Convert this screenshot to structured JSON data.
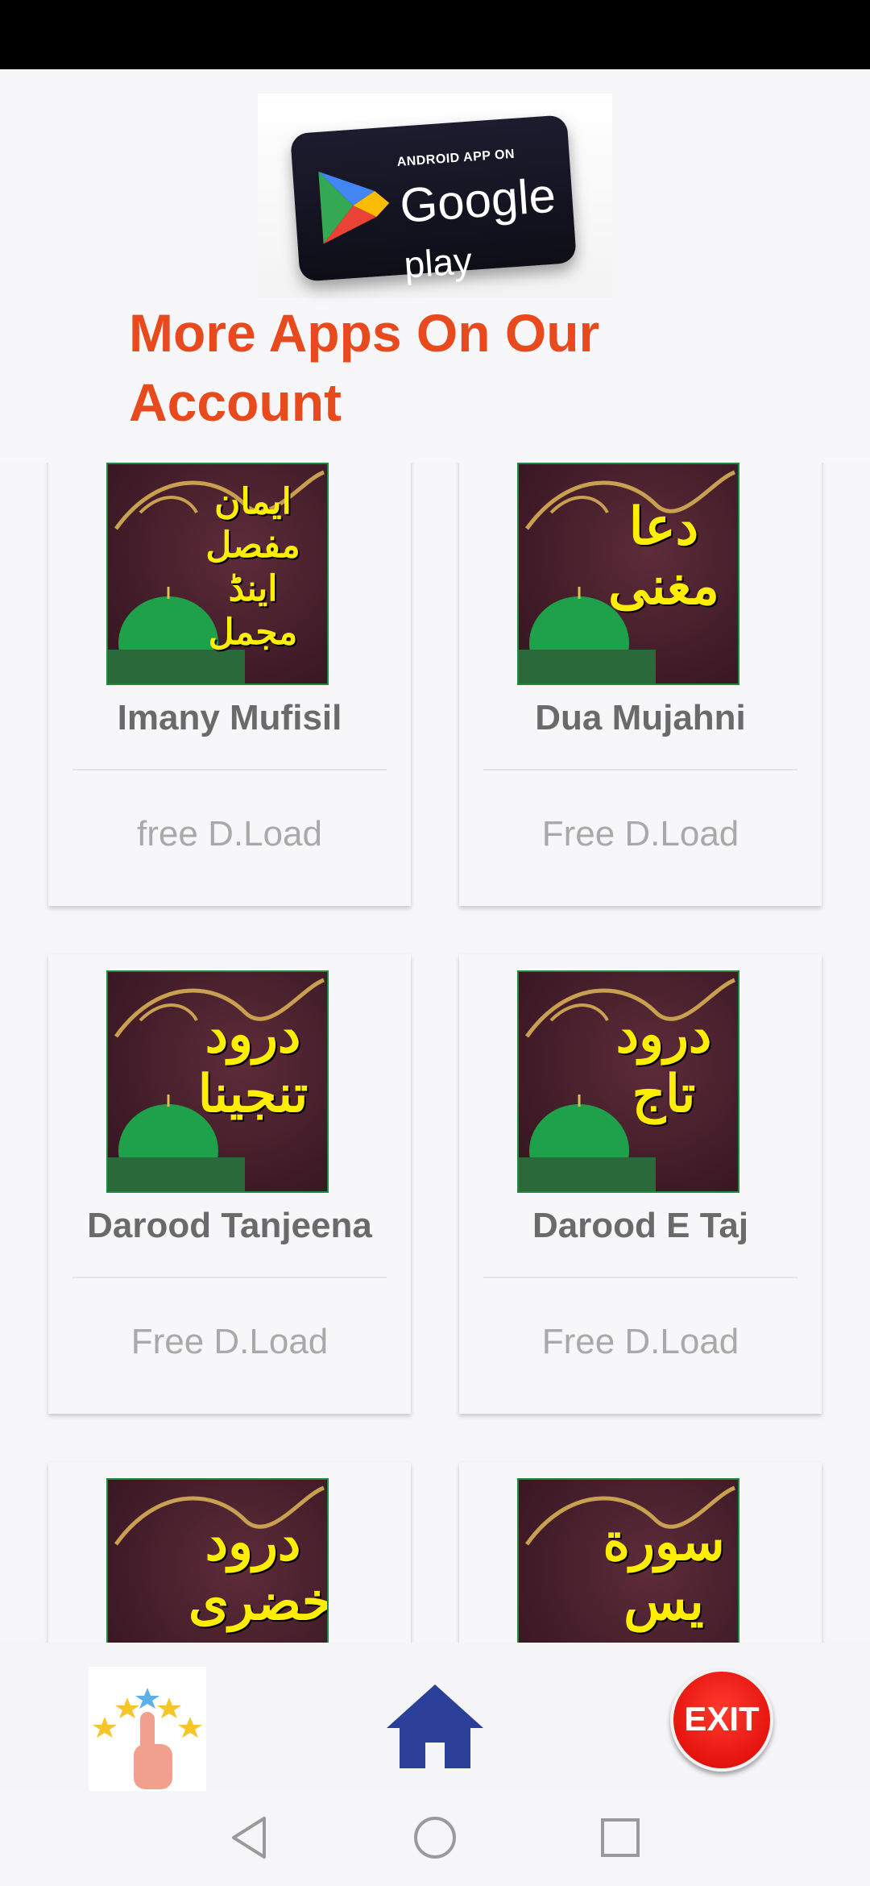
{
  "header": {
    "banner_small_text": "ANDROID APP ON",
    "banner_brand": "Google",
    "banner_play": "play",
    "title": "More Apps On Our Account"
  },
  "apps": [
    {
      "title": "Imany Mufisil",
      "footer": "free D.Load",
      "art_text": "ایمان مفصل اینڈ مجمل"
    },
    {
      "title": "Dua Mujahni",
      "footer": "Free D.Load",
      "art_text": "دعا مغنی"
    },
    {
      "title": "Darood Tanjeena",
      "footer": "Free D.Load",
      "art_text": "درود تنجینا"
    },
    {
      "title": "Darood E Taj",
      "footer": "Free D.Load",
      "art_text": "درود تاج"
    },
    {
      "title": "",
      "footer": "",
      "art_text": "درود خضری"
    },
    {
      "title": "",
      "footer": "",
      "art_text": "سورة يس"
    }
  ],
  "bottom_bar": {
    "rate_icon": "rate-stars-hand-icon",
    "home_icon": "home-icon",
    "exit_label": "EXIT"
  },
  "nav": {
    "back_icon": "back-triangle-icon",
    "home_icon": "home-circle-icon",
    "recents_icon": "recents-square-icon"
  },
  "colors": {
    "title": "#e8491d",
    "home": "#2b3f99",
    "exit": "#e5140e",
    "card_text": "#6a6a6a",
    "footer_text": "#a9a9a9"
  }
}
